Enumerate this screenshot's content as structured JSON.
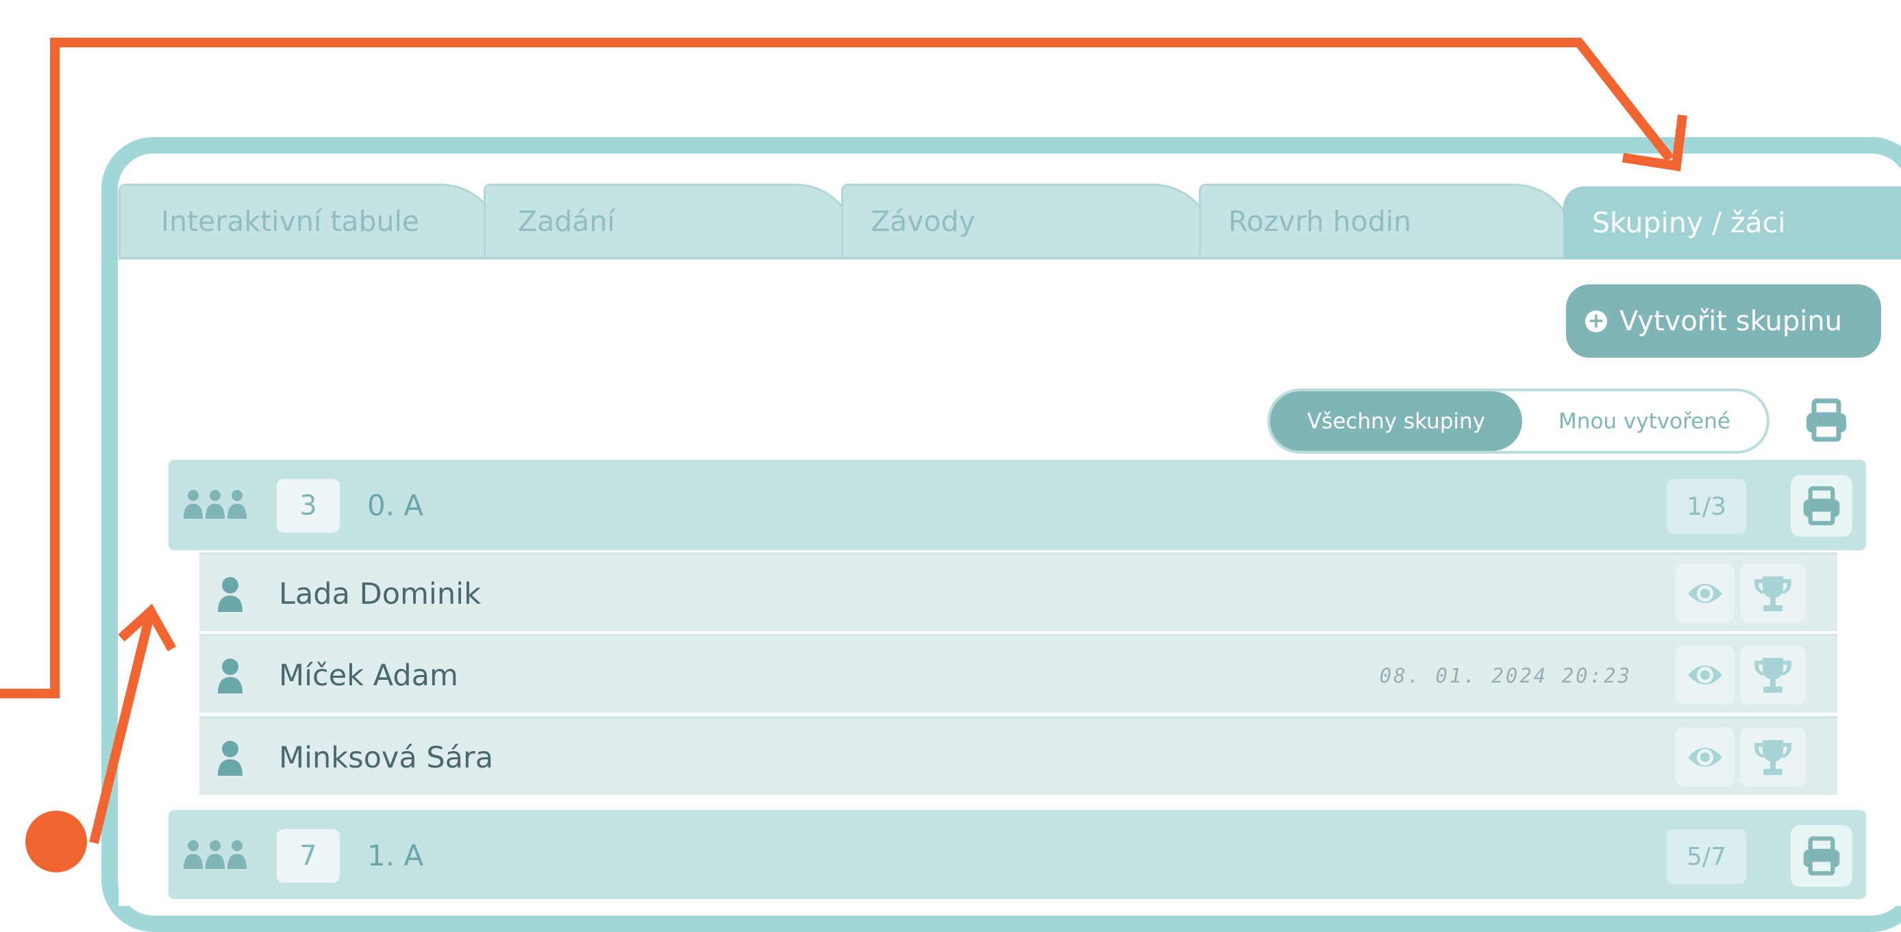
{
  "tabs": [
    {
      "label": "Interaktivní tabule",
      "active": false
    },
    {
      "label": "Zadání",
      "active": false
    },
    {
      "label": "Závody",
      "active": false
    },
    {
      "label": "Rozvrh hodin",
      "active": false
    },
    {
      "label": "Skupiny / žáci",
      "active": true
    }
  ],
  "toolbar": {
    "create_group_label": "Vytvořit skupinu",
    "create_group_icon": "plus-circle-icon",
    "print_icon": "printer-icon"
  },
  "filter": {
    "all_label": "Všechny skupiny",
    "mine_label": "Mnou vytvořené",
    "selected": "Všechny skupiny"
  },
  "groups": [
    {
      "count": "3",
      "name": "0. A",
      "ratio": "1/3",
      "icon": "group-people-icon",
      "expanded": true,
      "students": [
        {
          "name": "Lada Dominik",
          "timestamp": ""
        },
        {
          "name": "Míček Adam",
          "timestamp": "08. 01. 2024 20:23"
        },
        {
          "name": "Minksová Sára",
          "timestamp": ""
        }
      ]
    },
    {
      "count": "7",
      "name": "1. A",
      "ratio": "5/7",
      "icon": "group-people-icon",
      "expanded": false,
      "students": []
    }
  ],
  "colors": {
    "frame": "#a0d7d9",
    "accent": "#7fb5b7",
    "tab_inactive": "#c6e3e4",
    "tab_active": "#a0d2d4",
    "annotation": "#f26430",
    "student_row": "#e0edee",
    "student_name": "#49696d"
  }
}
